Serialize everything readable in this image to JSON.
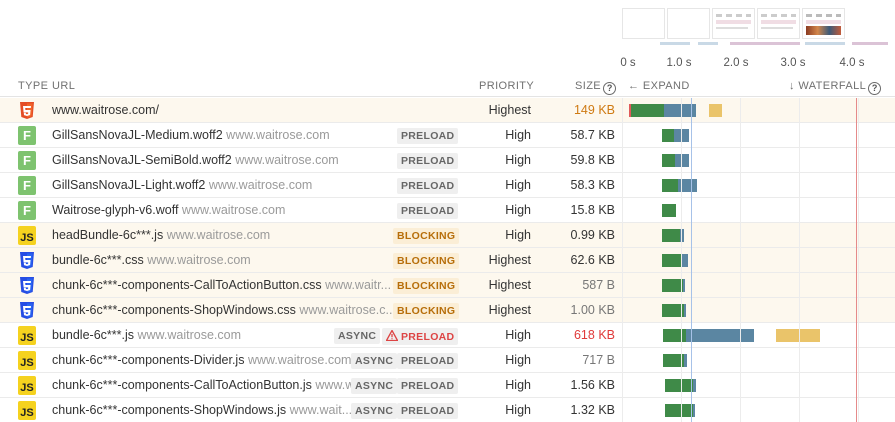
{
  "colors": {
    "connect": "#3f8a48",
    "download": "#5b86a2",
    "late": "#eac46a",
    "lcp_marker": "#e58a8a",
    "fcp_marker": "#a7c2e8"
  },
  "filmstrip": {
    "thumbs": [
      "blank",
      "blank",
      "header-only",
      "header-only",
      "hero-image"
    ]
  },
  "axis": {
    "ticks": [
      "0 s",
      "1.0 s",
      "2.0 s",
      "3.0 s",
      "4.0 s"
    ]
  },
  "header": {
    "type": "TYPE",
    "url": "URL",
    "priority": "PRIORITY",
    "size": "SIZE",
    "help_icon": "?",
    "expand": "← EXPAND",
    "waterfall": "↓ WATERFALL"
  },
  "requests": [
    {
      "type": "html",
      "icon": "html5-icon",
      "name": "www.waitrose.com/",
      "domain": "",
      "badges": [],
      "priority": "Highest",
      "size": "149 KB",
      "size_style": "orange",
      "hl": true
    },
    {
      "type": "font",
      "icon": "font-icon",
      "icon_text": "F",
      "name": "GillSansNovaJL-Medium.woff2",
      "domain": "www.waitrose.com",
      "badges": [
        {
          "kind": "preload",
          "text": "PRELOAD"
        }
      ],
      "priority": "High",
      "size": "58.7 KB",
      "size_style": "",
      "hl": false
    },
    {
      "type": "font",
      "icon": "font-icon",
      "icon_text": "F",
      "name": "GillSansNovaJL-SemiBold.woff2",
      "domain": "www.waitrose.com",
      "badges": [
        {
          "kind": "preload",
          "text": "PRELOAD"
        }
      ],
      "priority": "High",
      "size": "59.8 KB",
      "size_style": "",
      "hl": false
    },
    {
      "type": "font",
      "icon": "font-icon",
      "icon_text": "F",
      "name": "GillSansNovaJL-Light.woff2",
      "domain": "www.waitrose.com",
      "badges": [
        {
          "kind": "preload",
          "text": "PRELOAD"
        }
      ],
      "priority": "High",
      "size": "58.3 KB",
      "size_style": "",
      "hl": false
    },
    {
      "type": "font",
      "icon": "font-icon",
      "icon_text": "F",
      "name": "Waitrose-glyph-v6.woff",
      "domain": "www.waitrose.com",
      "badges": [
        {
          "kind": "preload",
          "text": "PRELOAD"
        }
      ],
      "priority": "High",
      "size": "15.8 KB",
      "size_style": "",
      "hl": false
    },
    {
      "type": "js",
      "icon": "js-icon",
      "icon_text": "JS",
      "name": "headBundle-6c***.js",
      "domain": "www.waitrose.com",
      "badges": [
        {
          "kind": "blocking",
          "text": "BLOCKING"
        }
      ],
      "priority": "High",
      "size": "0.99 KB",
      "size_style": "",
      "hl": true
    },
    {
      "type": "css",
      "icon": "css3-icon",
      "name": "bundle-6c***.css",
      "domain": "www.waitrose.com",
      "badges": [
        {
          "kind": "blocking",
          "text": "BLOCKING"
        }
      ],
      "priority": "Highest",
      "size": "62.6 KB",
      "size_style": "",
      "hl": true
    },
    {
      "type": "css",
      "icon": "css3-icon",
      "name": "chunk-6c***-components-CallToActionButton.css",
      "domain": "www.waitr...",
      "badges": [
        {
          "kind": "blocking",
          "text": "BLOCKING"
        }
      ],
      "priority": "Highest",
      "size": "587 B",
      "size_style": "gray",
      "hl": true
    },
    {
      "type": "css",
      "icon": "css3-icon",
      "name": "chunk-6c***-components-ShopWindows.css",
      "domain": "www.waitrose.c...",
      "badges": [
        {
          "kind": "blocking",
          "text": "BLOCKING"
        }
      ],
      "priority": "Highest",
      "size": "1.00 KB",
      "size_style": "gray",
      "hl": true
    },
    {
      "type": "js",
      "icon": "js-icon",
      "icon_text": "JS",
      "name": "bundle-6c***.js",
      "domain": "www.waitrose.com",
      "badges": [
        {
          "kind": "async",
          "text": "ASYNC"
        },
        {
          "kind": "warn",
          "text": "PRELOAD"
        }
      ],
      "priority": "High",
      "size": "618 KB",
      "size_style": "red",
      "hl": false
    },
    {
      "type": "js",
      "icon": "js-icon",
      "icon_text": "JS",
      "name": "chunk-6c***-components-Divider.js",
      "domain": "www.waitrose.com",
      "badges": [
        {
          "kind": "async",
          "text": "ASYNC"
        },
        {
          "kind": "preload",
          "text": "PRELOAD"
        }
      ],
      "priority": "High",
      "size": "717 B",
      "size_style": "gray",
      "hl": false
    },
    {
      "type": "js",
      "icon": "js-icon",
      "icon_text": "JS",
      "name": "chunk-6c***-components-CallToActionButton.js",
      "domain": "www.waitrose.com",
      "badges": [
        {
          "kind": "async",
          "text": "ASYNC"
        },
        {
          "kind": "preload",
          "text": "PRELOAD"
        }
      ],
      "priority": "High",
      "size": "1.56 KB",
      "size_style": "",
      "hl": false
    },
    {
      "type": "js",
      "icon": "js-icon",
      "icon_text": "JS",
      "name": "chunk-6c***-components-ShopWindows.js",
      "domain": "www.wait...",
      "badges": [
        {
          "kind": "async",
          "text": "ASYNC"
        },
        {
          "kind": "preload",
          "text": "PRELOAD"
        }
      ],
      "priority": "High",
      "size": "1.32 KB",
      "size_style": "",
      "hl": false
    }
  ]
}
